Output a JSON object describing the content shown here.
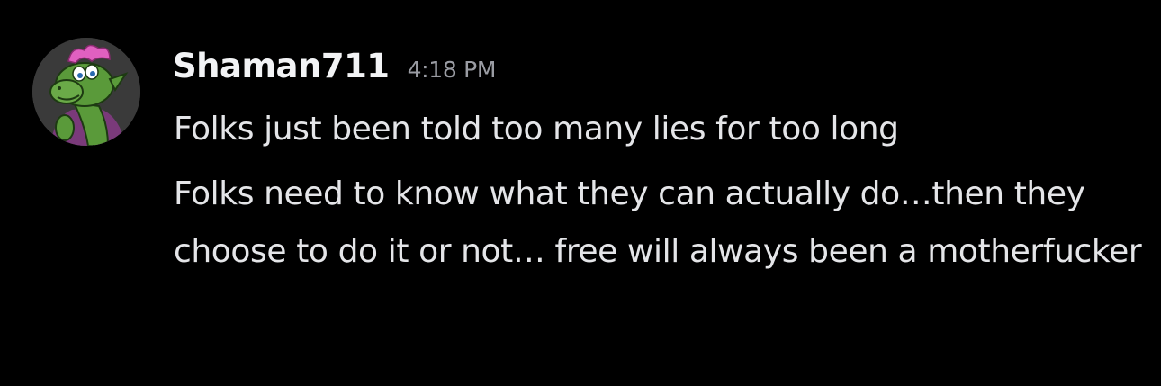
{
  "message": {
    "author": "Shaman711",
    "timestamp": "4:18 PM",
    "lines": [
      "Folks just been told too many lies for too long",
      "Folks need to know what they can actually do…then they choose to do it or not… free will always been a motherfucker"
    ]
  },
  "avatar": {
    "icon": "cartoon-dragon-avatar-icon",
    "colors": {
      "background": "#3a3a3a",
      "skin": "#5a9a3a",
      "hair": "#e060c0",
      "shirt": "#7a3a7a"
    }
  },
  "colors": {
    "background": "#000000",
    "username": "#f2f3f5",
    "timestamp": "#9a9ca3",
    "text": "#e4e5e8"
  }
}
